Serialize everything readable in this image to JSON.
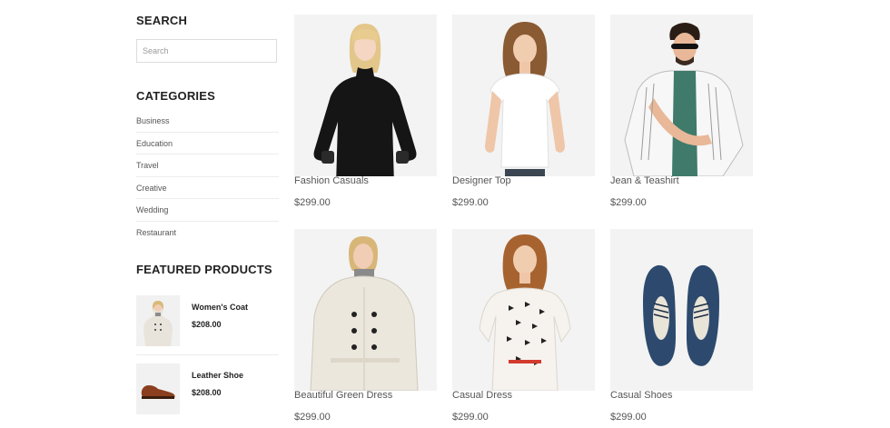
{
  "sidebar": {
    "search": {
      "heading": "SEARCH",
      "placeholder": "Search"
    },
    "categories": {
      "heading": "CATEGORIES",
      "items": [
        "Business",
        "Education",
        "Travel",
        "Creative",
        "Wedding",
        "Restaurant"
      ]
    },
    "featured": {
      "heading": "FEATURED PRODUCTS",
      "items": [
        {
          "name": "Women's Coat",
          "price": "$208.00"
        },
        {
          "name": "Leather Shoe",
          "price": "$208.00"
        }
      ]
    }
  },
  "products": [
    {
      "title": "Fashion Casuals",
      "price": "$299.00"
    },
    {
      "title": "Designer Top",
      "price": "$299.00"
    },
    {
      "title": "Jean & Teashirt",
      "price": "$299.00"
    },
    {
      "title": "Beautiful Green Dress",
      "price": "$299.00"
    },
    {
      "title": "Casual Dress",
      "price": "$299.00"
    },
    {
      "title": "Casual Shoes",
      "price": "$299.00"
    }
  ],
  "colors": {
    "heading": "#222222",
    "card_background": "#f3f3f3",
    "text": "#555555"
  }
}
